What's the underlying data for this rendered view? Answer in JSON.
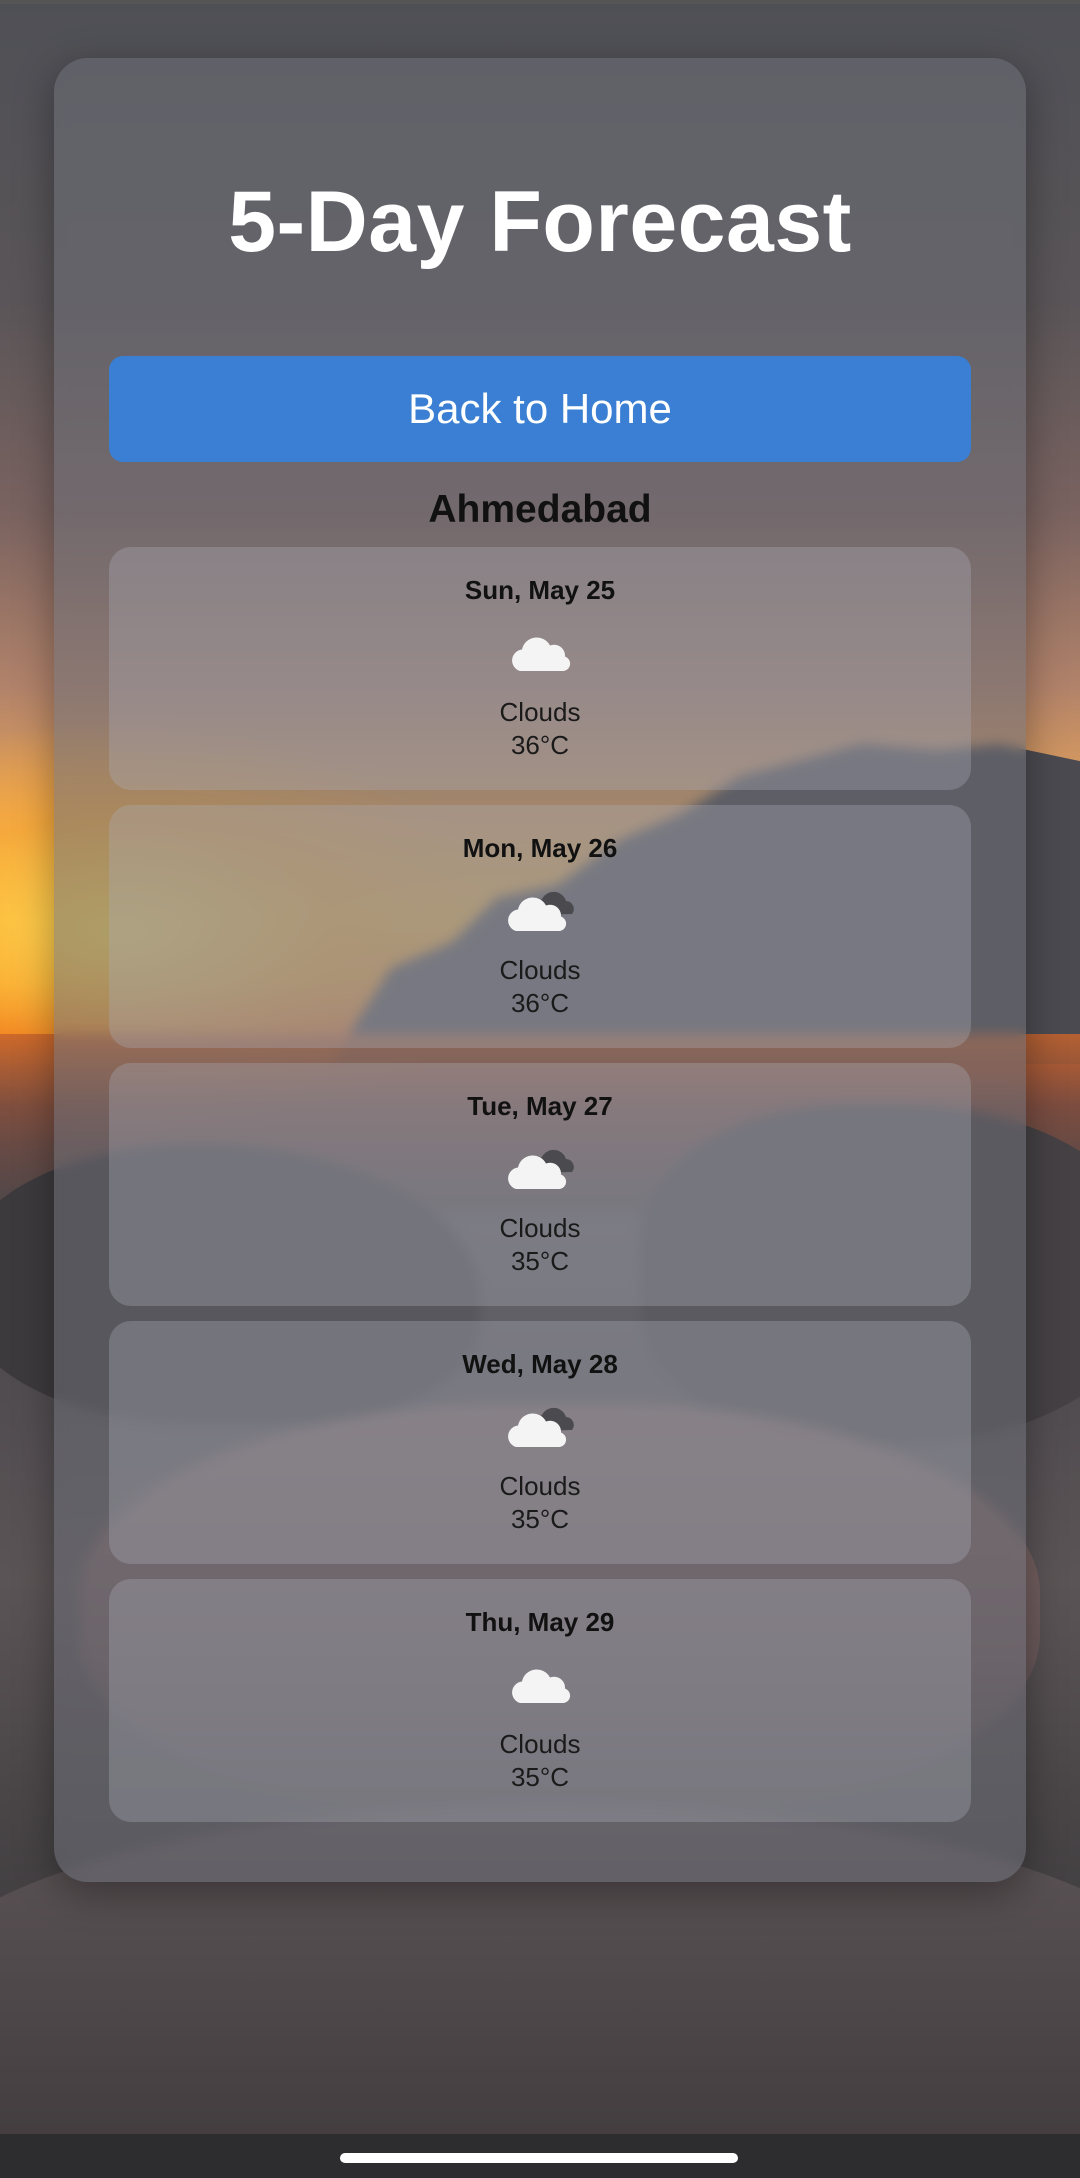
{
  "page": {
    "title": "5-Day Forecast",
    "back_button_label": "Back to Home",
    "city": "Ahmedabad"
  },
  "forecast": [
    {
      "date": "Sun, May 25",
      "icon": "cloud-icon",
      "description": "Clouds",
      "temperature": "36°C"
    },
    {
      "date": "Mon, May 26",
      "icon": "broken-clouds-icon",
      "description": "Clouds",
      "temperature": "36°C"
    },
    {
      "date": "Tue, May 27",
      "icon": "broken-clouds-icon",
      "description": "Clouds",
      "temperature": "35°C"
    },
    {
      "date": "Wed, May 28",
      "icon": "broken-clouds-icon",
      "description": "Clouds",
      "temperature": "35°C"
    },
    {
      "date": "Thu, May 29",
      "icon": "cloud-icon",
      "description": "Clouds",
      "temperature": "35°C"
    }
  ],
  "colors": {
    "button": "#3a7fd3",
    "title_text": "#ffffff",
    "card_text": "#111111"
  }
}
